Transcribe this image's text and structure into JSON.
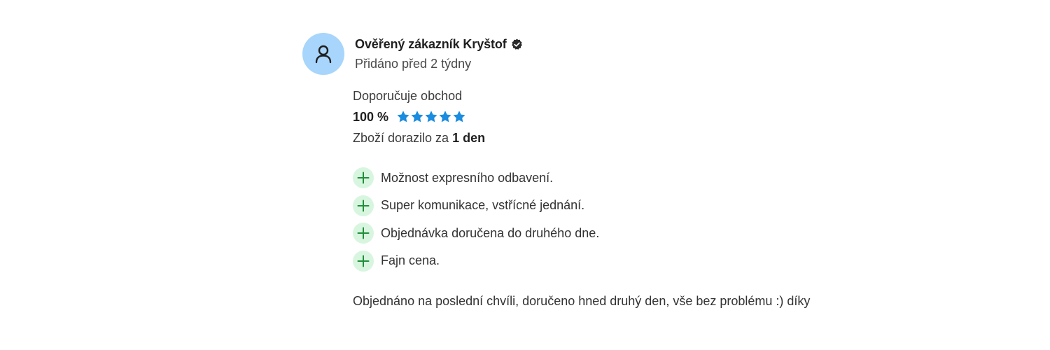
{
  "review": {
    "author": "Ověřený zákazník Kryštof",
    "added": "Přidáno před 2 týdny",
    "recommend": "Doporučuje obchod",
    "rating_percent": "100 %",
    "stars": 5,
    "delivery_prefix": "Zboží dorazilo za ",
    "delivery_value": "1 den",
    "pros": [
      "Možnost expresního odbavení.",
      "Super komunikace, vstřícné jednání.",
      "Objednávka doručena do druhého dne.",
      "Fajn cena."
    ],
    "comment": "Objednáno na poslední chvíli, doručeno hned druhý den, vše bez problému :) díky"
  },
  "colors": {
    "avatar_bg": "#a7d5fb",
    "star": "#1a8de0",
    "plus_bg": "#d8f6df",
    "plus_icon": "#1f8f3a"
  },
  "icons": {
    "avatar": "user-icon",
    "verified": "verified-check-icon",
    "star": "star-icon",
    "pro": "plus-icon"
  }
}
